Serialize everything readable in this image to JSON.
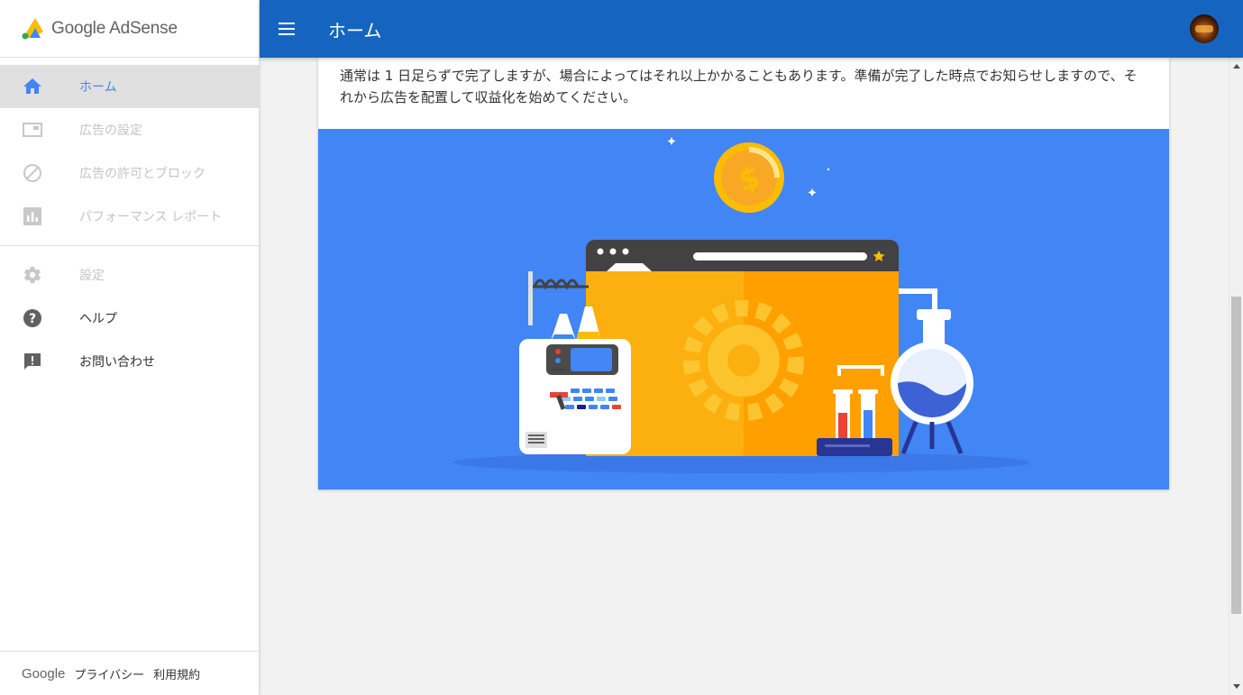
{
  "app": {
    "logo_text": "Google AdSense",
    "brand_colors": {
      "topbar": "#1565c0",
      "accent": "#4285f4",
      "logo_yellow": "#fbbc04"
    }
  },
  "header": {
    "title": "ホーム",
    "menu_icon": "hamburger-menu-icon",
    "avatar_icon": "user-avatar"
  },
  "sidebar": {
    "items": [
      {
        "label": "ホーム",
        "icon": "home-icon",
        "state": "active"
      },
      {
        "label": "広告の設定",
        "icon": "ad-unit-icon",
        "state": "disabled"
      },
      {
        "label": "広告の許可とブロック",
        "icon": "block-icon",
        "state": "disabled"
      },
      {
        "label": "パフォーマンス レポート",
        "icon": "bar-chart-icon",
        "state": "disabled"
      },
      {
        "label": "設定",
        "icon": "gear-icon",
        "state": "disabled"
      },
      {
        "label": "ヘルプ",
        "icon": "help-icon",
        "state": "enabled"
      },
      {
        "label": "お問い合わせ",
        "icon": "feedback-icon",
        "state": "enabled"
      }
    ],
    "footer": {
      "google": "Google",
      "privacy": "プライバシー",
      "terms": "利用規約"
    }
  },
  "main": {
    "card": {
      "message": "通常は 1 日足らずで完了しますが、場合によってはそれ以上かかることもあります。準備が完了した時点でお知らせしますので、それから広告を配置して収益化を始めてください。",
      "illustration_icon": "lab-setup-illustration",
      "illustration_bg": "#4285f4"
    }
  }
}
